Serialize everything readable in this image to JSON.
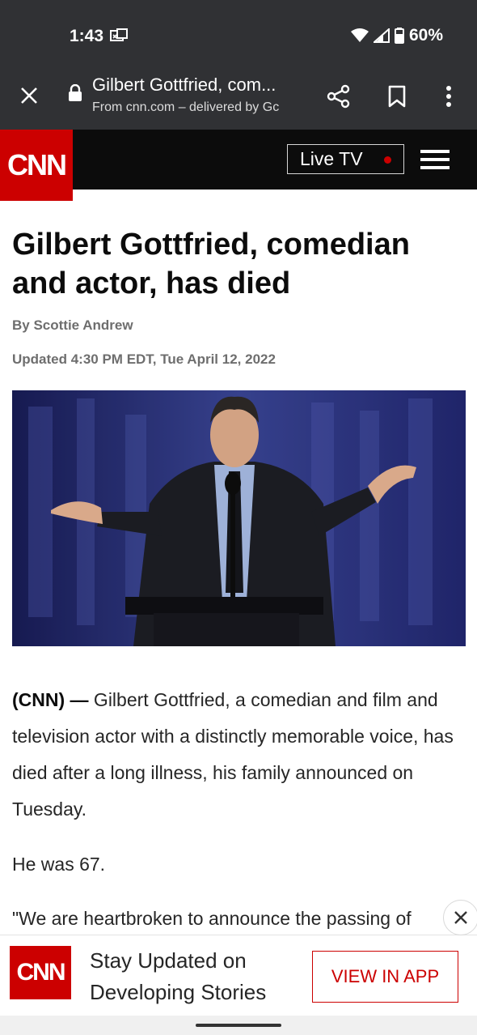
{
  "status_bar": {
    "time": "1:43",
    "battery": "60%",
    "icons": [
      "notification-icon",
      "wifi-icon",
      "signal-icon",
      "battery-icon"
    ]
  },
  "tab_bar": {
    "title": "Gilbert Gottfried, com...",
    "subtitle": "From cnn.com – delivered by Gc",
    "icons": [
      "close-icon",
      "lock-icon",
      "share-icon",
      "bookmark-icon",
      "more-vert-icon"
    ]
  },
  "header": {
    "logo": "CNN",
    "live_tv": "Live TV",
    "live_dot_color": "#cc0000",
    "brand_color": "#cc0000"
  },
  "article": {
    "headline": "Gilbert Gottfried, comedian and actor, has died",
    "byline": "By Scottie Andrew",
    "updated": "Updated 4:30 PM EDT, Tue April 12, 2022",
    "dateline": "(CNN) —",
    "p1": " Gilbert Gottfried, a comedian and film and television actor with a distinctly memorable voice, has died after a long illness, his family announced on Tuesday.",
    "p2": "He was 67.",
    "p3": "\"We are heartbroken to announce the passing of"
  },
  "banner": {
    "logo": "CNN",
    "text": "Stay Updated on Developing Stories",
    "button": "VIEW IN APP"
  }
}
